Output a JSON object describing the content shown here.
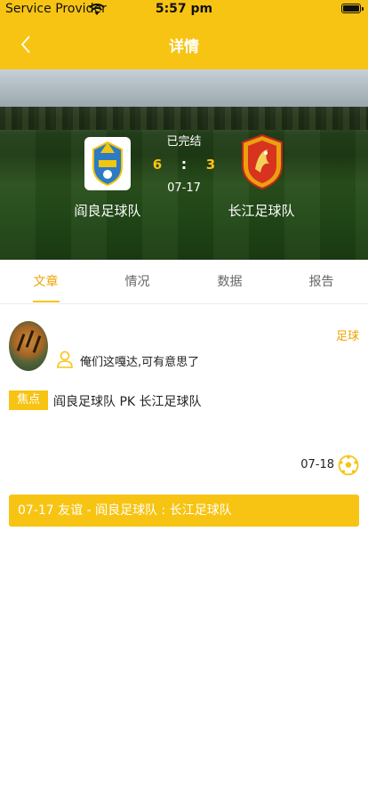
{
  "status_bar": {
    "carrier": "Service Provider",
    "time": "5:57 pm"
  },
  "nav": {
    "title": "详情",
    "back_icon": "chevron-left-icon"
  },
  "match": {
    "status": "已完结",
    "home_team": "阎良足球队",
    "away_team": "长江足球队",
    "home_score": "6",
    "separator": ":",
    "away_score": "3",
    "date": "07-17"
  },
  "tabs": [
    {
      "label": "文章",
      "active": true
    },
    {
      "label": "情况",
      "active": false
    },
    {
      "label": "数据",
      "active": false
    },
    {
      "label": "报告",
      "active": false
    }
  ],
  "article": {
    "category": "足球",
    "text": "俺们这嘎达,可有意思了",
    "focus_badge": "焦点",
    "focus_text": "阎良足球队 PK 长江足球队",
    "date": "07-18"
  },
  "banner": {
    "text": "07-17 友谊 - 阎良足球队 : 长江足球队"
  },
  "colors": {
    "accent": "#f7c413",
    "tab_active": "#f0a300"
  }
}
